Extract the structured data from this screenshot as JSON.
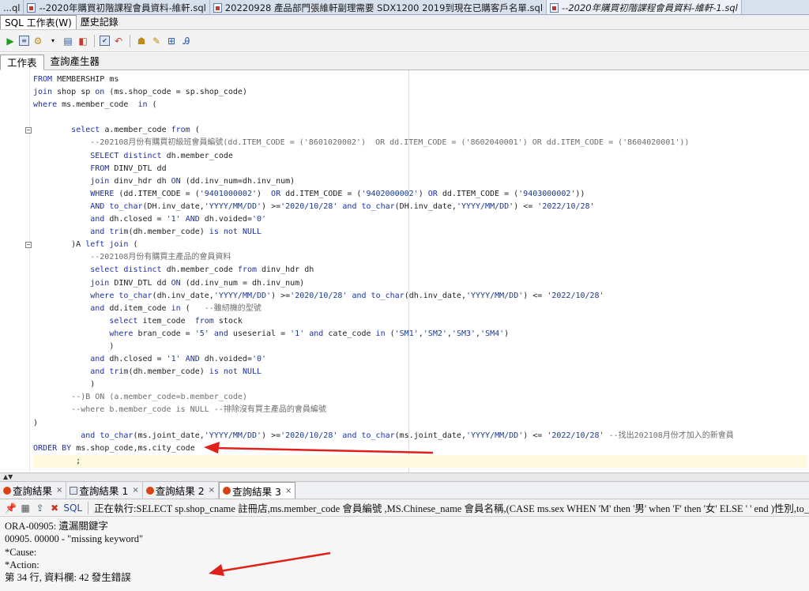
{
  "file_tabs": [
    {
      "label": "...ql",
      "active": false
    },
    {
      "label": "--2020年購買初階課程會員資料-維軒.sql",
      "active": false
    },
    {
      "label": "20220928 產品部門張維軒副理需要 SDX1200  2019到現在已購客戶名單.sql",
      "active": false
    },
    {
      "label": "--2020年購買初階課程會員資料-維軒-1.sql",
      "active": true
    }
  ],
  "sub_tabs": [
    "SQL 工作表(W)",
    "歷史記錄"
  ],
  "work_tabs": [
    "工作表",
    "查詢產生器"
  ],
  "result_tabs": [
    {
      "label": "查詢結果",
      "active": false
    },
    {
      "label": "查詢結果 1",
      "active": false
    },
    {
      "label": "查詢結果 2",
      "active": false
    },
    {
      "label": "查詢結果 3",
      "active": true
    }
  ],
  "result_toolbar": {
    "sql_label": "SQL",
    "status": "正在執行:SELECT sp.shop_cname 註冊店,ms.member_code 會員編號 ,MS.Chinese_name 會員名稱,(CASE ms.sex WHEN 'M' then '男' when 'F' then '女' ELSE ' ' end  )性別,to_"
  },
  "output_lines": [
    "ORA-00905: 遺漏關鍵字",
    "00905. 00000 -  \"missing keyword\"",
    "*Cause:",
    "*Action:",
    "第 34 行, 資料欄: 42 發生錯誤"
  ],
  "code_lines": [
    "FROM MEMBERSHIP ms",
    "join shop sp on (ms.shop_code = sp.shop_code)",
    "where ms.member_code  in (",
    "",
    "        select a.member_code from (",
    "            --202108月份有購買初級班會員編號(dd.ITEM_CODE = ('8601020002')  OR dd.ITEM_CODE = ('8602040001') OR dd.ITEM_CODE = ('8604020001'))",
    "            SELECT distinct dh.member_code",
    "            FROM DINV_DTL dd",
    "            join dinv_hdr dh ON (dd.inv_num=dh.inv_num)",
    "            WHERE (dd.ITEM_CODE = ('9401000002')  OR dd.ITEM_CODE = ('9402000002') OR dd.ITEM_CODE = ('9403000002'))",
    "            AND to_char(DH.inv_date,'YYYY/MM/DD') >='2020/10/28' and to_char(DH.inv_date,'YYYY/MM/DD') <= '2022/10/28'",
    "            and dh.closed = '1' AND dh.voided='0'",
    "            and trim(dh.member_code) is not NULL",
    "        )A left join (",
    "            --202108月份有購買主產品的會員資料",
    "            select distinct dh.member_code from dinv_hdr dh",
    "            join DINV_DTL dd ON (dd.inv_num = dh.inv_num)",
    "            where to_char(dh.inv_date,'YYYY/MM/DD') >='2020/10/28' and to_char(dh.inv_date,'YYYY/MM/DD') <= '2022/10/28'",
    "            and dd.item_code in (   --雖紉機的型號",
    "                select item_code  from stock",
    "                where bran_code = '5' and useserial = '1' and cate_code in ('SM1','SM2','SM3','SM4')",
    "                )",
    "            and dh.closed = '1' AND dh.voided='0'",
    "            and trim(dh.member_code) is not NULL",
    "            )",
    "        --)B ON (a.member_code=b.member_code)",
    "        --where b.member_code is NULL --排除沒有買主產品的會員編號",
    ")",
    "          and to_char(ms.joint_date,'YYYY/MM/DD') >='2020/10/28' and to_char(ms.joint_date,'YYYY/MM/DD') <= '2022/10/28' --找出202108月份才加入的新會員",
    "ORDER BY ms.shop_code,ms.city_code",
    "         ;"
  ],
  "icons": {
    "run": "run-statement-icon",
    "run_script": "run-script-icon",
    "commit": "commit-icon",
    "rollback": "rollback-icon",
    "pin": "pin-icon",
    "print": "print-icon",
    "export": "export-icon",
    "delete": "delete-icon"
  },
  "colors": {
    "keyword": "#1c30a8",
    "comment": "#6d6d6d",
    "arrow": "#e0201a"
  }
}
